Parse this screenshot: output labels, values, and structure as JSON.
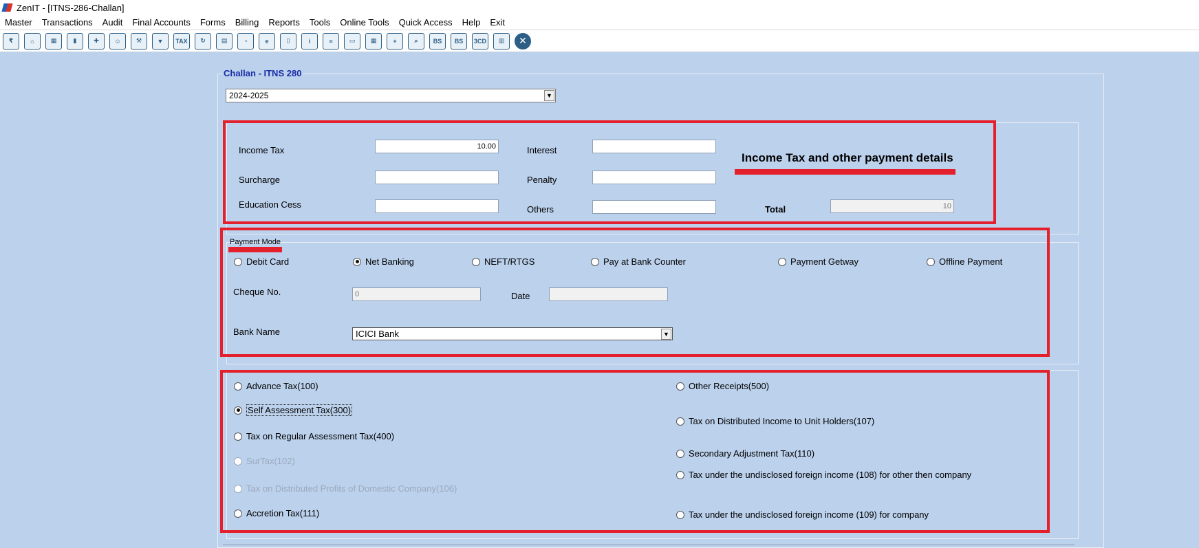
{
  "window": {
    "title": "ZenIT - [ITNS-286-Challan]"
  },
  "menu": [
    "Master",
    "Transactions",
    "Audit",
    "Final Accounts",
    "Forms",
    "Billing",
    "Reports",
    "Tools",
    "Online Tools",
    "Quick Access",
    "Help",
    "Exit"
  ],
  "toolbar": [
    {
      "name": "rupee-icon",
      "glyph": "₹"
    },
    {
      "name": "home-icon",
      "glyph": "⌂"
    },
    {
      "name": "building-icon",
      "glyph": "▦"
    },
    {
      "name": "bar-chart-icon",
      "glyph": "▮"
    },
    {
      "name": "gift-icon",
      "glyph": "✚"
    },
    {
      "name": "users-icon",
      "glyph": "☺"
    },
    {
      "name": "gavel-icon",
      "glyph": "⚒"
    },
    {
      "name": "filter-icon",
      "glyph": "▼"
    },
    {
      "name": "tax-icon",
      "glyph": "TAX"
    },
    {
      "name": "refresh-icon",
      "glyph": "↻"
    },
    {
      "name": "calculator-icon",
      "glyph": "▤"
    },
    {
      "name": "pie-chart-icon",
      "glyph": "◔"
    },
    {
      "name": "epay-icon",
      "glyph": "e"
    },
    {
      "name": "book-icon",
      "glyph": "▯"
    },
    {
      "name": "info-icon",
      "glyph": "i"
    },
    {
      "name": "report-icon",
      "glyph": "≡"
    },
    {
      "name": "user-doc-icon",
      "glyph": "▭"
    },
    {
      "name": "calendar-icon",
      "glyph": "▦"
    },
    {
      "name": "add-folder-icon",
      "glyph": "+"
    },
    {
      "name": "search-doc-icon",
      "glyph": "⌕"
    },
    {
      "name": "balance-sheet-icon",
      "glyph": "BS"
    },
    {
      "name": "balance-sheet-2-icon",
      "glyph": "BS"
    },
    {
      "name": "3cd-icon",
      "glyph": "3CD"
    },
    {
      "name": "form-icon",
      "glyph": "▥"
    },
    {
      "name": "close-icon",
      "glyph": "✕"
    }
  ],
  "form": {
    "title": "Challan - ITNS 280",
    "assessment_year": "2024-2025",
    "amounts": {
      "income_tax_label": "Income Tax",
      "income_tax_value": "10.00",
      "surcharge_label": "Surcharge",
      "surcharge_value": "",
      "education_cess_label": "Education Cess",
      "education_cess_value": "",
      "interest_label": "Interest",
      "interest_value": "",
      "penalty_label": "Penalty",
      "penalty_value": "",
      "others_label": "Others",
      "others_value": "",
      "total_label": "Total",
      "total_value": "10"
    },
    "amounts_callout": "Income Tax and other payment details",
    "payment_mode": {
      "legend": "Payment Mode",
      "options": [
        "Debit Card",
        "Net Banking",
        "NEFT/RTGS",
        "Pay at Bank Counter",
        "Payment Getway",
        "Offline Payment"
      ],
      "selected": "Net Banking",
      "cheque_label": "Cheque No.",
      "cheque_value": "0",
      "date_label": "Date",
      "date_value": "",
      "bank_label": "Bank Name",
      "bank_value": "ICICI Bank"
    },
    "tax_types": {
      "left": [
        "Advance Tax(100)",
        "Self Assessment Tax(300)",
        "Tax on Regular Assessment Tax(400)",
        "SurTax(102)",
        "Tax on Distributed Profits of Domestic Company(106)",
        "Accretion Tax(111)"
      ],
      "right": [
        "Other Receipts(500)",
        "Tax on Distributed Income to Unit Holders(107)",
        "Secondary Adjustment Tax(110)",
        "Tax under the undisclosed foreign income (108) for other then company",
        "Tax under the undisclosed foreign income (109) for  company"
      ],
      "selected": "Self Assessment Tax(300)",
      "disabled": [
        "SurTax(102)",
        "Tax on Distributed Profits of Domestic Company(106)"
      ]
    }
  },
  "colors": {
    "background": "#bcd1ec",
    "annotation_red": "#e3202b",
    "title_blue": "#1a2ea6"
  }
}
